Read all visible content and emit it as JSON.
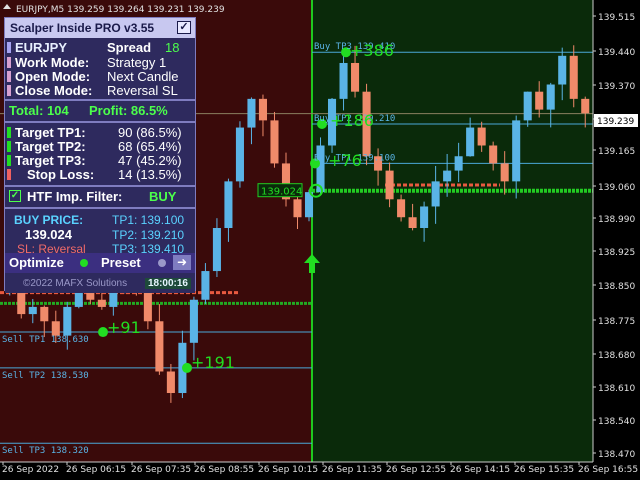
{
  "symbol": {
    "title": "EURJPY,M5",
    "ohlc": "139.259 139.264 139.231 139.239"
  },
  "panel": {
    "title": "Scalper Inside PRO v3.55",
    "symbol": "EURJPY",
    "spread_label": "Spread",
    "spread_value": "18",
    "work_mode_label": "Work Mode:",
    "work_mode_value": "Strategy 1",
    "open_mode_label": "Open Mode:",
    "open_mode_value": "Next Candle",
    "close_mode_label": "Close Mode:",
    "close_mode_value": "Reversal SL",
    "total": "Total: 104",
    "profit": "Profit: 86.5%",
    "tp1_label": "Target TP1:",
    "tp1_value": "90 (86.5%)",
    "tp2_label": "Target TP2:",
    "tp2_value": "68 (65.4%)",
    "tp3_label": "Target TP3:",
    "tp3_value": "47 (45.2%)",
    "sl_label": "Stop Loss:",
    "sl_value": "14 (13.5%)",
    "htf_label": "HTF Imp. Filter:",
    "htf_value": "BUY",
    "buy_price_label": "BUY PRICE:",
    "buy_price_value": "139.024",
    "sl_text": "SL: Reversal",
    "tp1_line": "TP1: 139.100",
    "tp2_line": "TP2: 139.210",
    "tp3_line": "TP3: 139.410",
    "optimize": "Optimize",
    "preset": "Preset",
    "copyright": "©2022 MAFX Solutions",
    "clock": "18:00:16"
  },
  "price_axis": [
    "139.515",
    "139.440",
    "139.370",
    "139.300",
    "139.239",
    "139.165",
    "139.060",
    "138.990",
    "138.925",
    "138.850",
    "138.775",
    "138.680",
    "138.610",
    "138.540",
    "138.470",
    "138.400",
    "138.330"
  ],
  "current_price": "139.239",
  "time_axis": [
    "26 Sep 2022",
    "26 Sep 06:15",
    "26 Sep 07:35",
    "26 Sep 08:55",
    "26 Sep 10:15",
    "26 Sep 11:35",
    "26 Sep 12:55",
    "26 Sep 14:15",
    "26 Sep 15:35",
    "26 Sep 16:55"
  ],
  "chart_labels": {
    "buy_tp3": "Buy TP3 139.410",
    "buy_tp2": "Buy TP2 139.210",
    "buy_tp1": "Buy TP1 139.100",
    "sell_tp1": "Sell TP1 138.630",
    "sell_tp2": "Sell TP2 138.530",
    "sell_tp3": "Sell TP3 138.320",
    "entry": "139.024",
    "p386": "+386",
    "p186": "+186",
    "p76": "+76",
    "p91": "+91",
    "p191": "+191"
  },
  "colors": {
    "sell_zone": "#3a0a0a",
    "buy_zone": "#0a2a0a",
    "bull": "#5ab4e6",
    "bear": "#f08a6a",
    "accent": "#22dd22"
  }
}
